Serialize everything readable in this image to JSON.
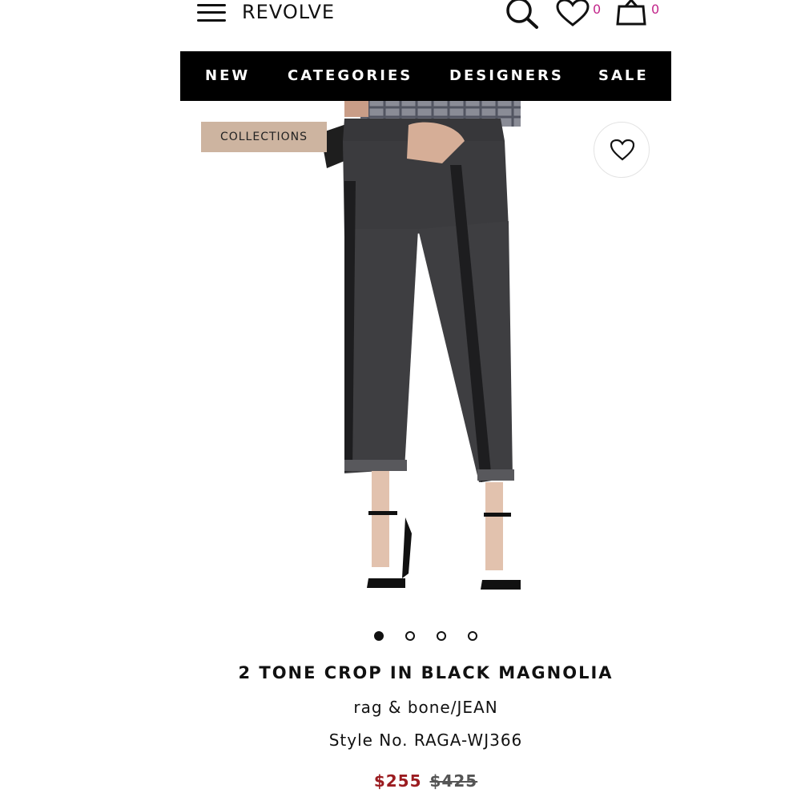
{
  "header": {
    "logo": "REVOLVE",
    "wishlist_count": "0",
    "bag_count": "0",
    "icons": [
      "menu-icon",
      "search-icon",
      "heart-icon",
      "shopping-bag-icon"
    ]
  },
  "nav": {
    "items": [
      {
        "label": "NEW"
      },
      {
        "label": "CATEGORIES"
      },
      {
        "label": "DESIGNERS"
      },
      {
        "label": "SALE"
      }
    ]
  },
  "gallery": {
    "tag": "COLLECTIONS",
    "slide_count": 4,
    "active_slide": 1
  },
  "product": {
    "title": "2 TONE CROP IN BLACK MAGNOLIA",
    "brand": "rag & bone/JEAN",
    "style": "Style No. RAGA-WJ366",
    "sale_price": "$255",
    "original_price": "$425"
  },
  "colors": {
    "nav_bg": "#000000",
    "tag_bg": "#cdb4a0",
    "sale_price": "#9b1c20",
    "count_badge": "#c2258a"
  }
}
